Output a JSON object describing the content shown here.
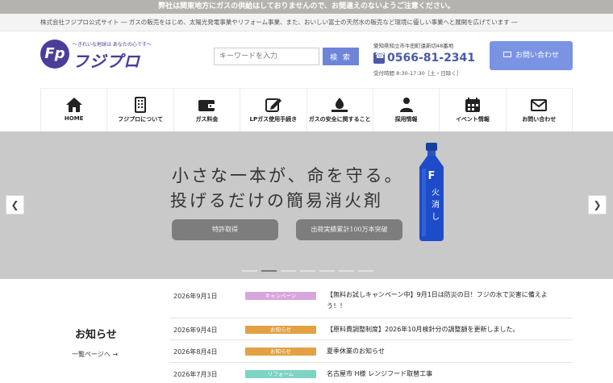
{
  "notice": "弊社は関東地方にガスの供給はしておりませんので、お間違えのないようご注意ください。",
  "tagline": "株式会社フジプロ公式サイト ― ガスの販売をはじめ、太陽光発電事業やリフォーム事業、また、おいしい富士の天然水の販売など環境に優しい事業へと展開を広げています ―",
  "logo": {
    "subtitle": "〜きれいな地球は あなたの心です〜",
    "name": "フジプロ",
    "mark": "Fp"
  },
  "search": {
    "placeholder": "キーワードを入力",
    "button": "検 索"
  },
  "contact": {
    "address": "愛知県知立市牛田町遠新切48番地",
    "phone": "0566-81-2341",
    "hours": "受付時間 8:30-17:30［土・日除く］",
    "button": "お問い合わせ"
  },
  "nav": [
    {
      "label": "HOME",
      "icon": "home-icon"
    },
    {
      "label": "フジプロについて",
      "icon": "building-icon"
    },
    {
      "label": "ガス料金",
      "icon": "wallet-icon"
    },
    {
      "label": "LPガス使用手続き",
      "icon": "edit-icon"
    },
    {
      "label": "ガスの安全に関すること",
      "icon": "safety-icon"
    },
    {
      "label": "採用情報",
      "icon": "person-icon"
    },
    {
      "label": "イベント情報",
      "icon": "calendar-icon"
    },
    {
      "label": "お問い合わせ",
      "icon": "mail-icon"
    }
  ],
  "hero": {
    "line1": "小さな一本が、命を守る。",
    "line2": "投げるだけの簡易消火剤",
    "pill1": "特許取得",
    "pill2": "出荷実績累計100万本突破",
    "bottle_text": "火消し"
  },
  "news": {
    "heading": "お知らせ",
    "more": "一覧ページへ →",
    "items": [
      {
        "date": "2026年9月1日",
        "tag": "キャンペーン",
        "tag_color": "#d8a6dd",
        "title": "【無料お試しキャンペーン中】9月1日は防災の日！フジの水で災害に備えよう！！"
      },
      {
        "date": "2026年9月4日",
        "tag": "お知らせ",
        "tag_color": "#e3a143",
        "title": "【原料費調整制度】2026年10月検針分の調整額を更新しました。"
      },
      {
        "date": "2026年8月4日",
        "tag": "お知らせ",
        "tag_color": "#e3a143",
        "title": "夏季休業のお知らせ"
      },
      {
        "date": "2026年7月3日",
        "tag": "リフォーム",
        "tag_color": "#7fd3c3",
        "title": "名古屋市 H様 レンジフード取替工事"
      }
    ]
  }
}
